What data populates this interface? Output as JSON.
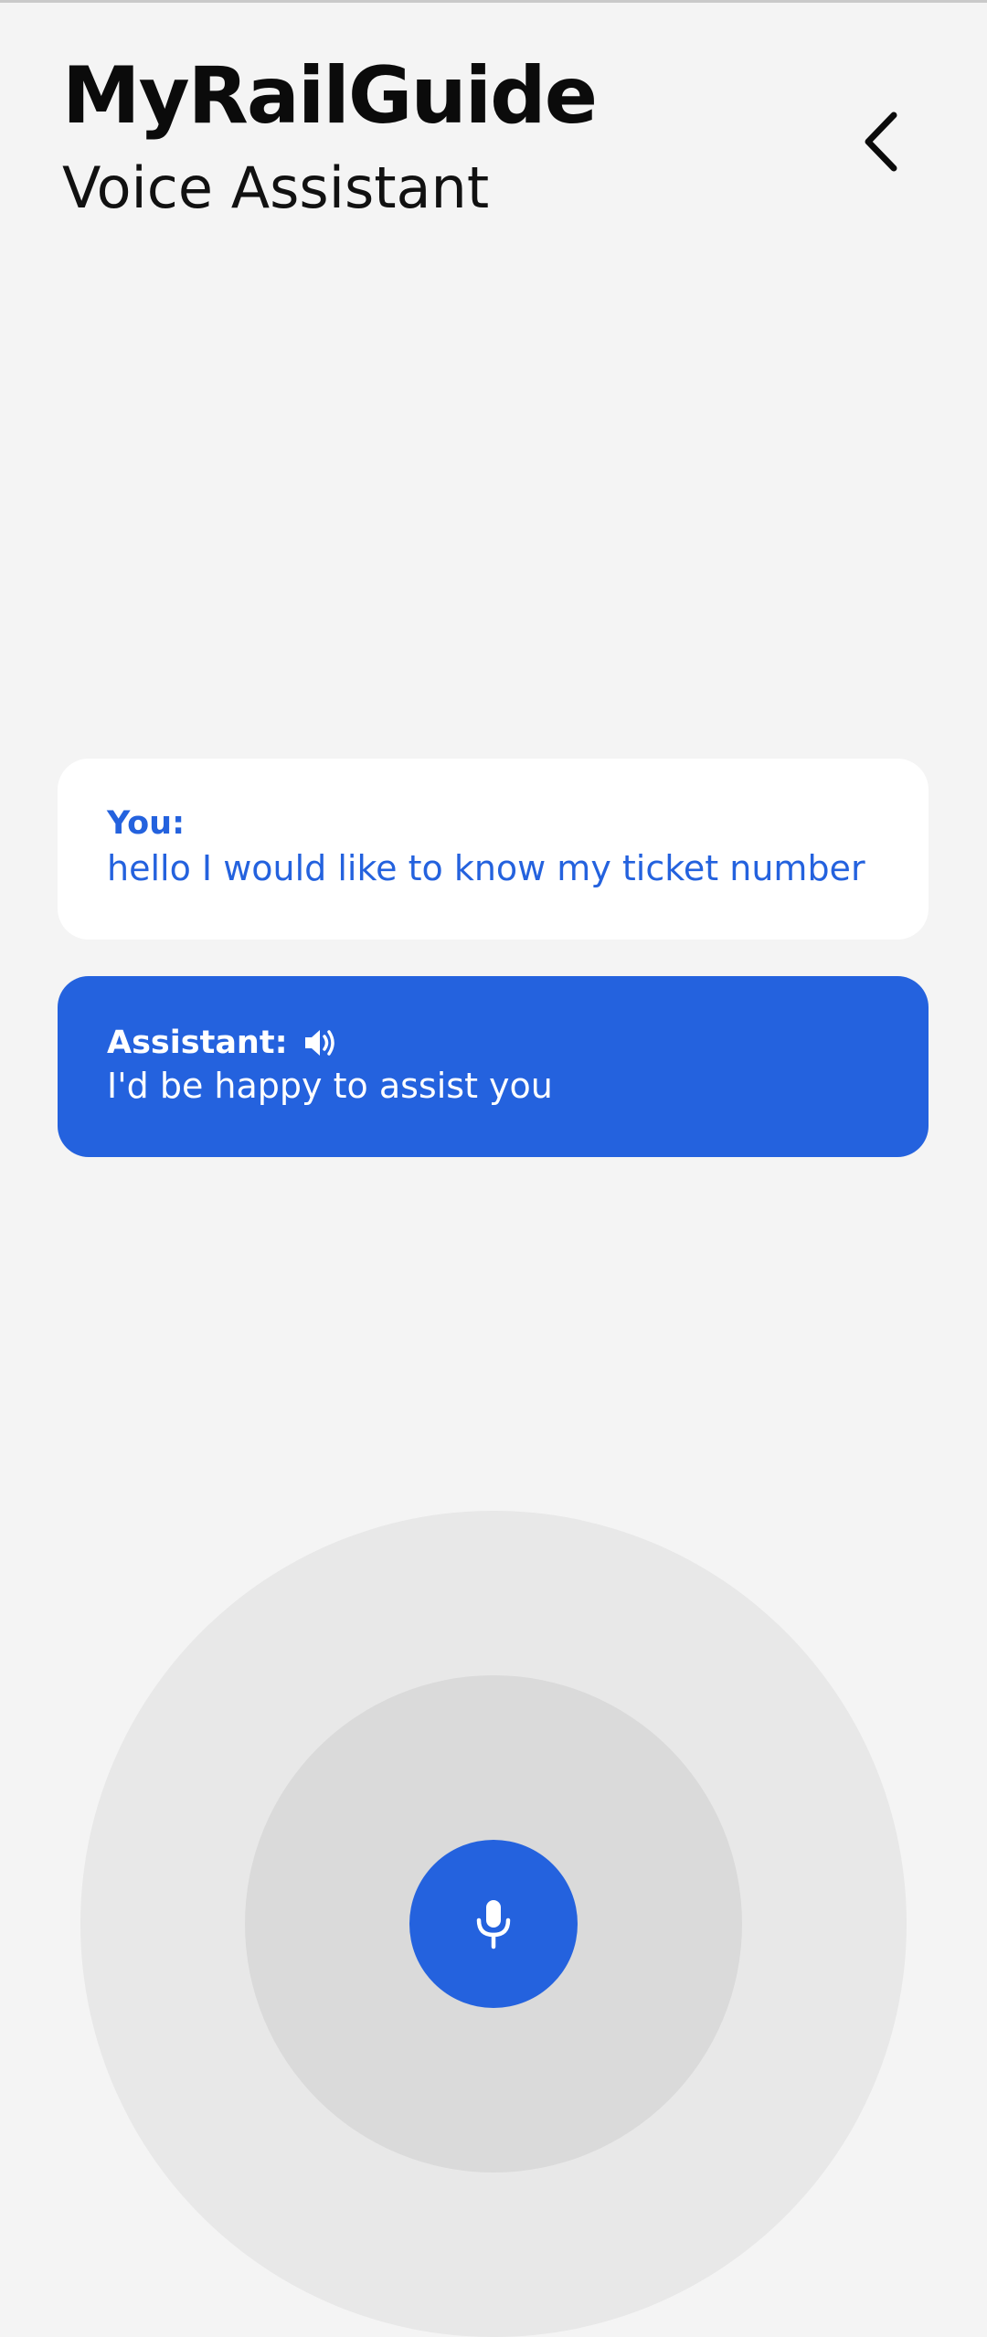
{
  "header": {
    "title": "MyRailGuide",
    "subtitle": "Voice Assistant",
    "back_icon": "chevron-left-icon"
  },
  "conversation": {
    "messages": [
      {
        "speaker": "You:",
        "text": "hello I would like to know my ticket number"
      },
      {
        "speaker": "Assistant:",
        "text": "I'd be happy to assist you",
        "icon": "speaker-icon"
      }
    ]
  },
  "mic": {
    "icon": "microphone-icon"
  },
  "colors": {
    "accent": "#2462de",
    "background": "#f4f4f4",
    "bubble_user": "#ffffff",
    "ring_outer": "#e8e8e8",
    "ring_inner": "#dadada"
  }
}
